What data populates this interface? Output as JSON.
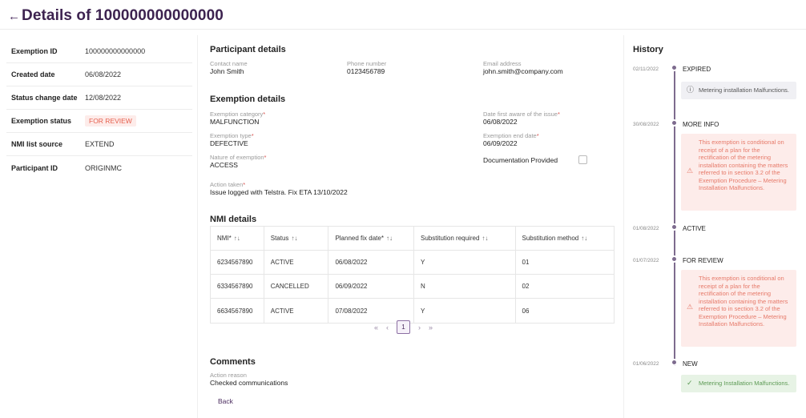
{
  "header": {
    "back_icon": "arrow-left-icon",
    "title": "Details of 100000000000000"
  },
  "summary": [
    {
      "label": "Exemption ID",
      "value": "100000000000000"
    },
    {
      "label": "Created date",
      "value": "06/08/2022"
    },
    {
      "label": "Status change date",
      "value": "12/08/2022"
    },
    {
      "label": "Exemption status",
      "value": "FOR REVIEW"
    },
    {
      "label": "NMI list source",
      "value": "EXTEND"
    },
    {
      "label": "Participant ID",
      "value": "ORIGINMC"
    }
  ],
  "participant": {
    "title": "Participant details",
    "contact_label": "Contact name",
    "contact_value": "John Smith",
    "phone_label": "Phone number",
    "phone_value": "0123456789",
    "email_label": "Email address",
    "email_value": "john.smith@company.com"
  },
  "exemption": {
    "title": "Exemption details",
    "category_label": "Exemption category",
    "category_value": "MALFUNCTION",
    "type_label": "Exemption type",
    "type_value": "DEFECTIVE",
    "nature_label": "Nature of exemption",
    "nature_value": "ACCESS",
    "aware_label": "Date first aware of the issue",
    "aware_value": "06/08/2022",
    "end_label": "Exemption end date",
    "end_value": "06/09/2022",
    "doc_label": "Documentation Provided",
    "action_label": "Action taken",
    "action_value": "Issue logged with Telstra. Fix ETA 13/10/2022",
    "required_mark": "*"
  },
  "nmi": {
    "title": "NMI details",
    "columns": [
      "NMI*",
      "Status",
      "Planned fix date*",
      "Substitution required",
      "Substitution method"
    ],
    "sort_icon": "↑↓",
    "rows": [
      [
        "6234567890",
        "ACTIVE",
        "06/08/2022",
        "Y",
        "01"
      ],
      [
        "6334567890",
        "CANCELLED",
        "06/09/2022",
        "N",
        "02"
      ],
      [
        "6634567890",
        "ACTIVE",
        "07/08/2022",
        "Y",
        "06"
      ]
    ],
    "pager": {
      "first": "«",
      "prev": "‹",
      "page": "1",
      "next": "›",
      "last": "»"
    }
  },
  "comments": {
    "title": "Comments",
    "reason_label": "Action reason",
    "reason_value": "Checked communications",
    "back_label": "Back"
  },
  "history": {
    "title": "History",
    "entries": [
      {
        "date": "02/11/2022",
        "status": "EXPIRED",
        "card_type": "info",
        "card_icon": "info-circle-icon",
        "card_text": "Metering installation Malfunctions."
      },
      {
        "date": "30/08/2022",
        "status": "MORE INFO",
        "card_type": "warn",
        "card_icon": "warning-triangle-icon",
        "card_text": "This exemption is conditional on receipt of a plan for the rectification of the metering installation containing the matters referred to in section 3.2 of the Exemption Procedure – Metering Installation Malfunctions."
      },
      {
        "date": "01/08/2022",
        "status": "ACTIVE"
      },
      {
        "date": "01/07/2022",
        "status": "FOR REVIEW",
        "card_type": "warn",
        "card_icon": "warning-triangle-icon",
        "card_text": "This exemption is conditional on receipt of a plan for the rectification of the metering installation containing the matters referred to in section 3.2 of the Exemption Procedure – Metering Installation Malfunctions."
      },
      {
        "date": "01/06/2022",
        "status": "NEW",
        "card_type": "success",
        "card_icon": "check-icon",
        "card_text": "Metering Installation Malfunctions."
      }
    ]
  },
  "colors": {
    "accent": "#3d2350",
    "timeline": "#7d6b8e",
    "warn_bg": "#fdecea",
    "warn_text": "#e67a6a",
    "success_bg": "#e7f3e5"
  }
}
